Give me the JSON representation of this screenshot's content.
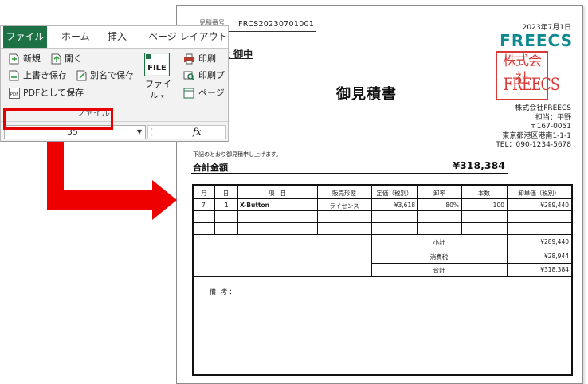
{
  "ribbon": {
    "tabs": [
      "ファイル",
      "ホーム",
      "挿入",
      "ページ レイアウト"
    ],
    "buttons": {
      "new": "新規",
      "open": "開く",
      "save": "上書き保存",
      "save_as": "別名で保存",
      "save_pdf": "PDFとして保存",
      "file_big_1": "ファイ",
      "file_big_2": "ル",
      "print": "印刷",
      "print_preview": "印刷プ",
      "page_setup": "ページ"
    },
    "file_icon_text": "FILE",
    "pdf_icon_text": "PDF",
    "group_label": "ファイル",
    "name_box_value": "35",
    "fx_label": "fx"
  },
  "document": {
    "doc_no_label": "見積番号",
    "doc_no": "FRCS20230701001",
    "date": "2023年7月1日",
    "logo": "FREECS",
    "seal_line1": "株式会社",
    "seal_line2": "FREECS",
    "client": "社  御中",
    "title": "御見積書",
    "company": [
      "株式会社FREECS",
      "担当：平野",
      "〒167-0051",
      "東京都港区港南1-1-1",
      "TEL：090-1234-5678"
    ],
    "intro": "下記のとおり御見積申し上げます。",
    "total_label": "合計金額",
    "total_value": "¥318,384",
    "table": {
      "headers": [
        "月",
        "日",
        "項　目",
        "販売形態",
        "定価（税別）",
        "卸率",
        "本数",
        "卸単価（税別）"
      ],
      "rows": [
        [
          "7",
          "1",
          "X-Button",
          "ライセンス",
          "¥3,618",
          "80%",
          "100",
          "¥289,440"
        ]
      ],
      "subtotal_label": "小計",
      "subtotal_value": "¥289,440",
      "tax_label": "消費税",
      "tax_value": "¥28,944",
      "grand_label": "合計",
      "grand_value": "¥318,384",
      "remarks_label": "備 考："
    }
  }
}
